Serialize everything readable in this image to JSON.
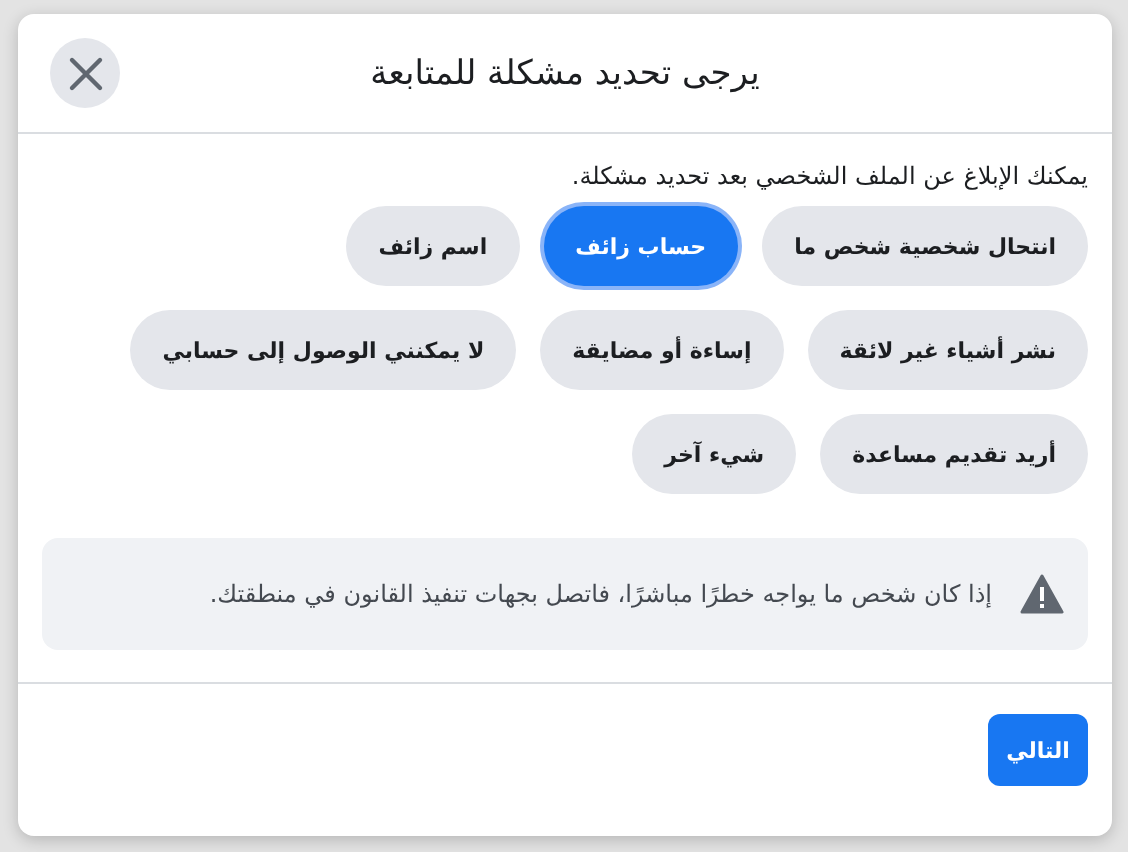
{
  "dialog": {
    "title": "يرجى تحديد مشكلة للمتابعة",
    "subtitle": "يمكنك الإبلاغ عن الملف الشخصي بعد تحديد مشكلة.",
    "options": [
      {
        "label": "انتحال شخصية شخص ما",
        "selected": false
      },
      {
        "label": "حساب زائف",
        "selected": true
      },
      {
        "label": "اسم زائف",
        "selected": false
      },
      {
        "label": "نشر أشياء غير لائقة",
        "selected": false
      },
      {
        "label": "إساءة أو مضايقة",
        "selected": false
      },
      {
        "label": "لا يمكنني الوصول إلى حسابي",
        "selected": false
      },
      {
        "label": "أريد تقديم مساعدة",
        "selected": false
      },
      {
        "label": "شيء آخر",
        "selected": false
      }
    ],
    "notice": "إذا كان شخص ما يواجه خطرًا مباشرًا، فاتصل بجهات تنفيذ القانون في منطقتك.",
    "next_button": "التالي"
  }
}
